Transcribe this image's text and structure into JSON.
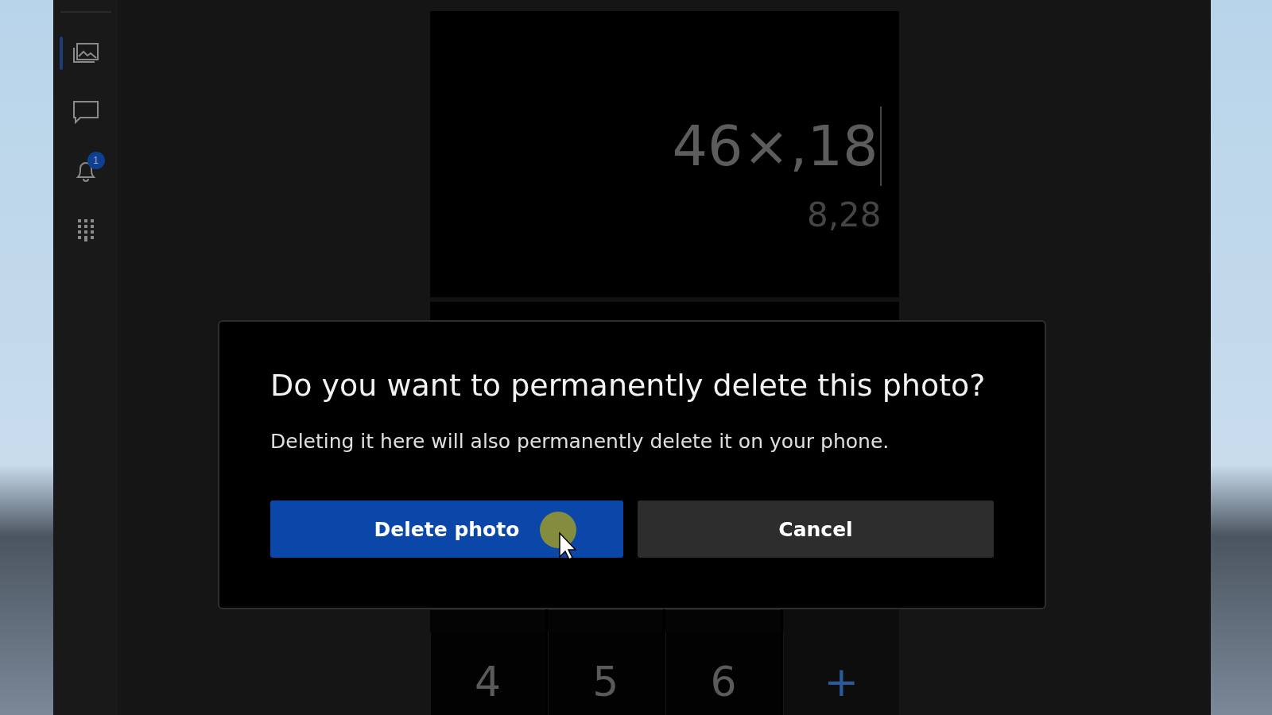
{
  "sidebar": {
    "items": [
      {
        "kind": "photos",
        "selected": true
      },
      {
        "kind": "messages",
        "selected": false
      },
      {
        "kind": "notifications",
        "selected": false,
        "badge": "1"
      },
      {
        "kind": "calls",
        "selected": false
      }
    ]
  },
  "phone_screen": {
    "expression": "46×,18",
    "result": "8,28",
    "keys": [
      {
        "label": "4",
        "kind": "digit"
      },
      {
        "label": "5",
        "kind": "digit"
      },
      {
        "label": "6",
        "kind": "digit"
      },
      {
        "label": "+",
        "kind": "operator"
      }
    ]
  },
  "dialog": {
    "title": "Do you want to permanently delete this photo?",
    "message": "Deleting it here will also permanently delete it on your phone.",
    "buttons": [
      {
        "label": "Delete photo",
        "kind": "primary"
      },
      {
        "label": "Cancel",
        "kind": "secondary"
      }
    ]
  }
}
